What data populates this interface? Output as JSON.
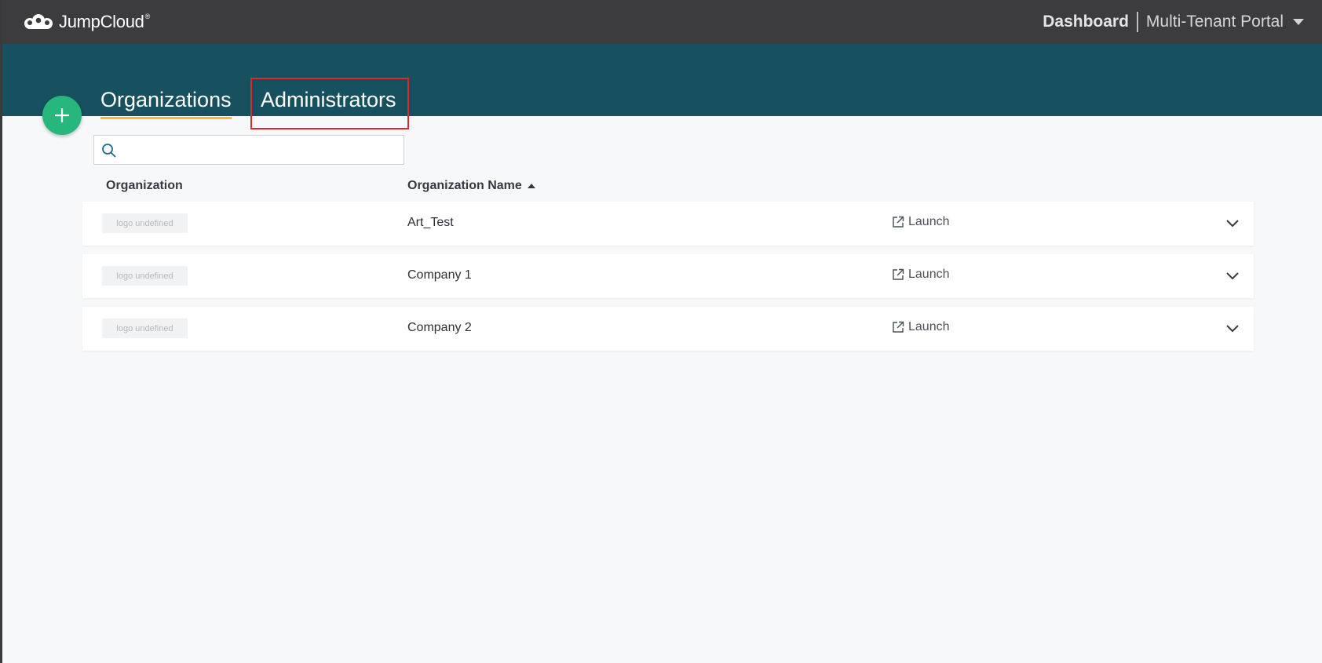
{
  "brand": {
    "name": "JumpCloud",
    "reg": "®"
  },
  "header": {
    "dashboard_label": "Dashboard",
    "portal_label": "Multi-Tenant Portal"
  },
  "tabs": [
    {
      "label": "Organizations",
      "active": true
    },
    {
      "label": "Administrators",
      "active": false
    }
  ],
  "search": {
    "placeholder": "",
    "value": ""
  },
  "table": {
    "columns": [
      "Organization",
      "Organization Name"
    ],
    "sort_column": "Organization Name",
    "sort_direction": "ascending",
    "rows": [
      {
        "logo_text": "logo undefined",
        "name": "Art_Test",
        "action": "Launch"
      },
      {
        "logo_text": "logo undefined",
        "name": "Company 1",
        "action": "Launch"
      },
      {
        "logo_text": "logo undefined",
        "name": "Company 2",
        "action": "Launch"
      }
    ]
  },
  "colors": {
    "topbar": "#3c3c3e",
    "banner": "#17505f",
    "add_button": "#27b77d",
    "active_tab_underline": "#f6b93b",
    "highlight_box": "#e0262b"
  },
  "icons": {
    "add": "plus-icon",
    "search": "search-icon",
    "launch": "external-link-icon",
    "expand": "chevron-down-icon",
    "menu": "caret-down-icon"
  }
}
